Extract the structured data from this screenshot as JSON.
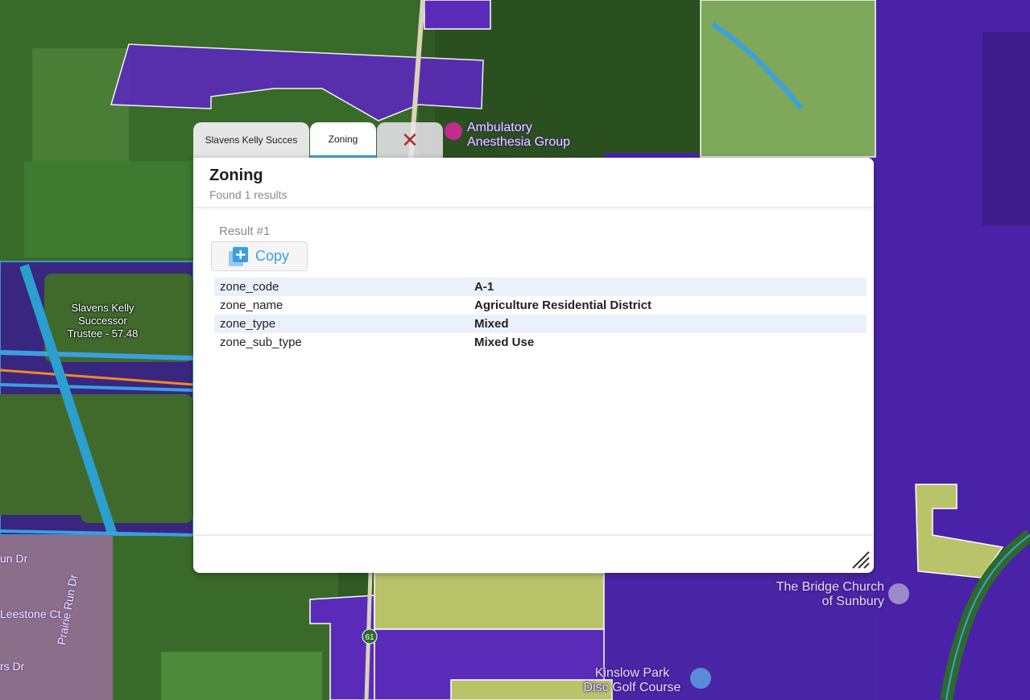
{
  "map": {
    "parcel_label": "Slavens Kelly\nSuccessor\nTrustee - 57.48",
    "pois": [
      {
        "id": "ambulatory",
        "text": "Ambulatory\nAnesthesia Group"
      },
      {
        "id": "bridge-church",
        "text": "The Bridge Church\nof Sunbury"
      },
      {
        "id": "kinslow",
        "text": "Kinslow Park\nDisc Golf Course"
      }
    ],
    "streets": [
      "Leestone Ct",
      "Prairie Run Dr",
      "rs Dr",
      "un Dr"
    ],
    "route_shield": "61",
    "colors": {
      "purple": "#5a2bb8",
      "deep_purple": "#3b1a8f",
      "lime": "#c9e07a",
      "road_blue": "#3aa0e0",
      "road_orange": "#f08a24"
    }
  },
  "tabs": [
    {
      "label": "Slavens Kelly Succes",
      "state": "inactive"
    },
    {
      "label": "Zoning",
      "state": "active"
    },
    {
      "icon": "close-icon",
      "glyph": "✕"
    }
  ],
  "panel": {
    "title": "Zoning",
    "subtitle": "Found 1 results",
    "result_label": "Result #1",
    "copy_label": "Copy",
    "rows": [
      {
        "key": "zone_code",
        "value": "A-1"
      },
      {
        "key": "zone_name",
        "value": "Agriculture Residential District"
      },
      {
        "key": "zone_type",
        "value": "Mixed"
      },
      {
        "key": "zone_sub_type",
        "value": "Mixed Use"
      }
    ]
  }
}
